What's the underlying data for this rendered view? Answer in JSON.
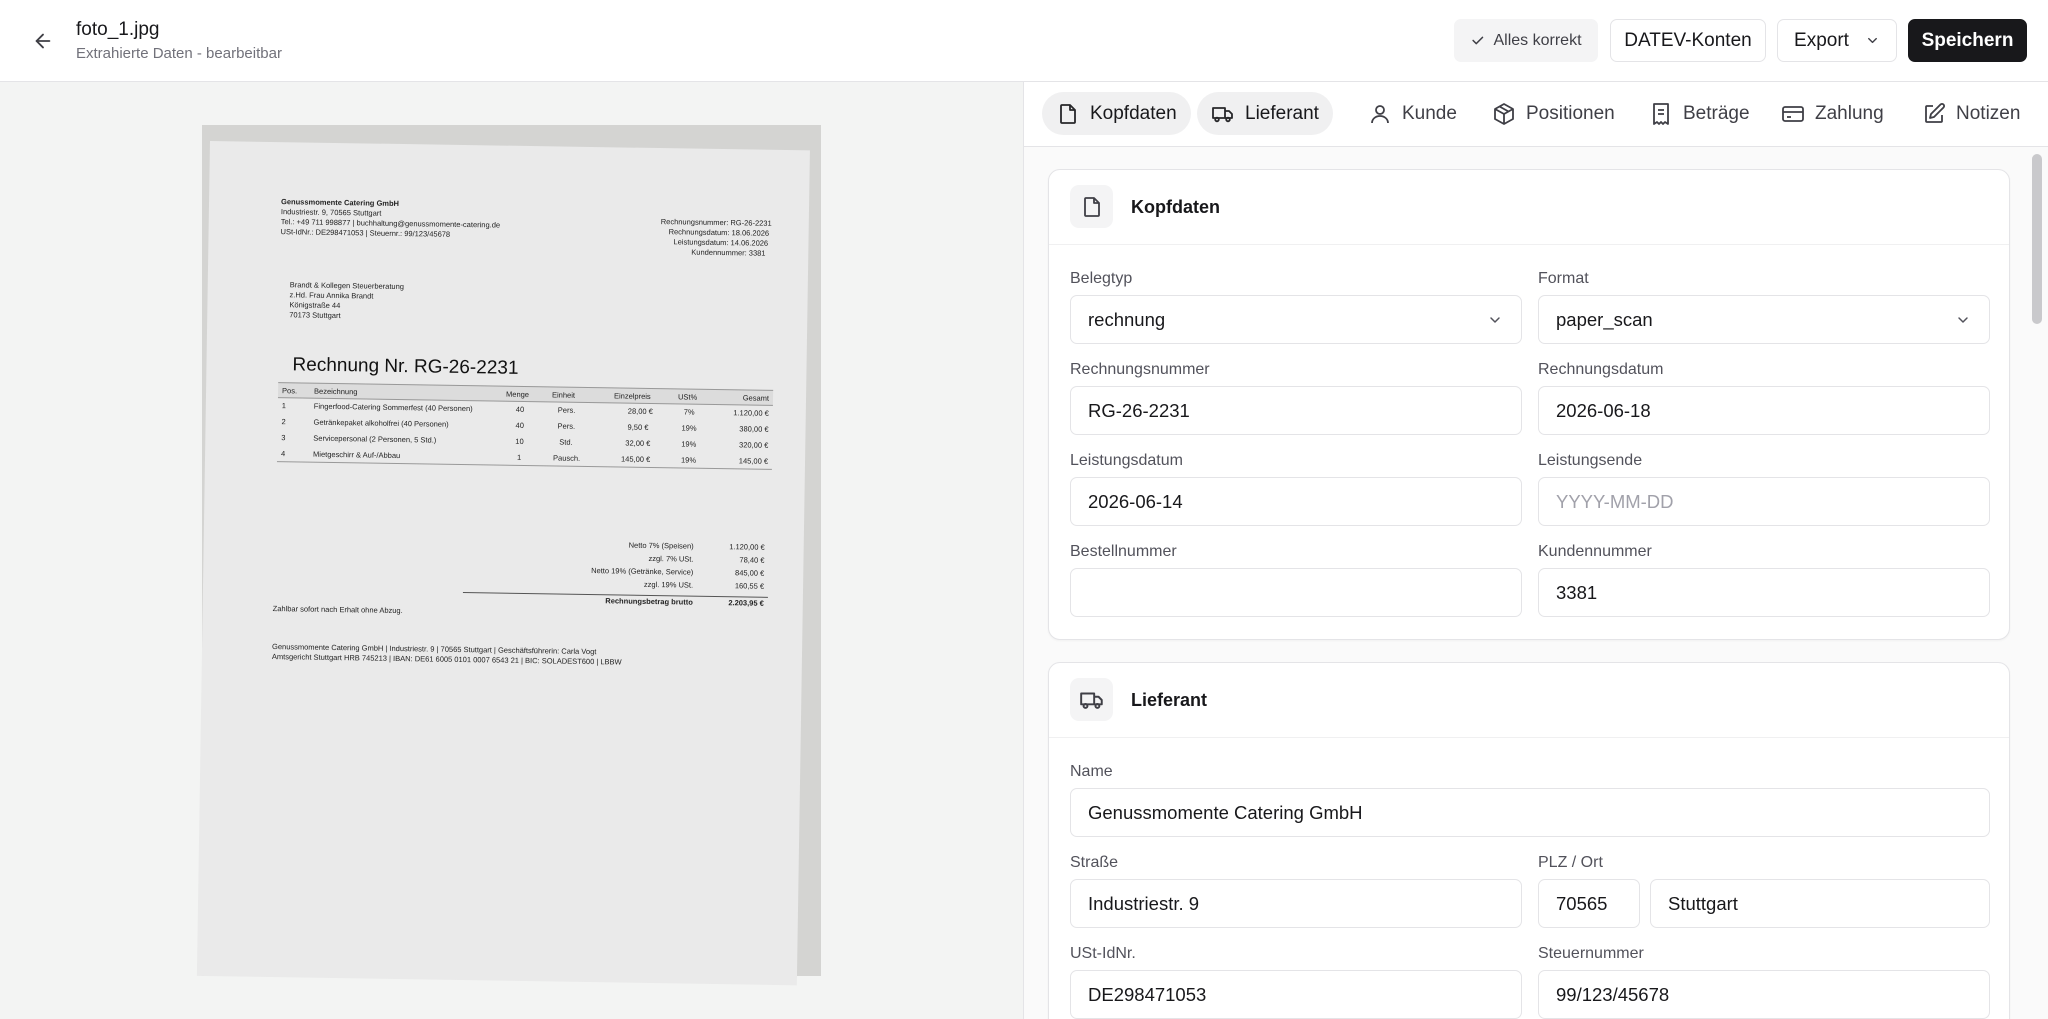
{
  "header": {
    "file_name": "foto_1.jpg",
    "subtitle": "Extrahierte Daten - bearbeitbar",
    "btn_ok": "Alles korrekt",
    "btn_datev": "DATEV-Konten",
    "btn_export": "Export",
    "btn_save": "Speichern"
  },
  "preview": {
    "sender_name": "Genussmomente Catering GmbH",
    "sender_line1": "Industriestr. 9, 70565 Stuttgart",
    "sender_line2": "Tel.: +49 711 998877 | buchhaltung@genussmomente-catering.de",
    "sender_line3": "USt-IdNr.: DE298471053 | Steuernr.: 99/123/45678",
    "meta_1": "Rechnungsnummer: RG-26-2231",
    "meta_2": "Rechnungsdatum: 18.06.2026",
    "meta_3": "Leistungsdatum: 14.06.2026",
    "meta_4": "Kundennummer: 3381",
    "recipient_1": "Brandt & Kollegen Steuerberatung",
    "recipient_2": "z.Hd. Frau Annika Brandt",
    "recipient_3": "Königstraße 44",
    "recipient_4": "70173 Stuttgart",
    "title": "Rechnung Nr. RG-26-2231",
    "table_headers": [
      "Pos.",
      "Bezeichnung",
      "Menge",
      "Einheit",
      "Einzelpreis",
      "USt%",
      "Gesamt"
    ],
    "rows": [
      [
        "1",
        "Fingerfood-Catering Sommerfest (40 Personen)",
        "40",
        "Pers.",
        "28,00 €",
        "7%",
        "1.120,00 €"
      ],
      [
        "2",
        "Getränkepaket alkoholfrei (40 Personen)",
        "40",
        "Pers.",
        "9,50 €",
        "19%",
        "380,00 €"
      ],
      [
        "3",
        "Servicepersonal (2 Personen, 5 Std.)",
        "10",
        "Std.",
        "32,00 €",
        "19%",
        "320,00 €"
      ],
      [
        "4",
        "Mietgeschirr & Auf-/Abbau",
        "1",
        "Pausch.",
        "145,00 €",
        "19%",
        "145,00 €"
      ]
    ],
    "sums": [
      [
        "Netto 7% (Speisen)",
        "1.120,00 €"
      ],
      [
        "zzgl. 7% USt.",
        "78,40 €"
      ],
      [
        "Netto 19% (Getränke, Service)",
        "845,00 €"
      ],
      [
        "zzgl. 19% USt.",
        "160,55 €"
      ]
    ],
    "total_label": "Rechnungsbetrag brutto",
    "total_value": "2.203,95 €",
    "payment_note": "Zahlbar sofort nach Erhalt ohne Abzug.",
    "footer_1": "Genussmomente Catering GmbH | Industriestr. 9 | 70565 Stuttgart | Geschäftsführerin: Carla Vogt",
    "footer_2": "Amtsgericht Stuttgart HRB 745213 | IBAN: DE61 6005 0101 0007 6543 21 | BIC: SOLADEST600 | LBBW"
  },
  "tabs": [
    "Kopfdaten",
    "Lieferant",
    "Kunde",
    "Positionen",
    "Beträge",
    "Zahlung",
    "Notizen"
  ],
  "kopfdaten": {
    "title": "Kopfdaten",
    "belegtyp_label": "Belegtyp",
    "belegtyp_value": "rechnung",
    "format_label": "Format",
    "format_value": "paper_scan",
    "rechnungsnummer_label": "Rechnungsnummer",
    "rechnungsnummer_value": "RG-26-2231",
    "rechnungsdatum_label": "Rechnungsdatum",
    "rechnungsdatum_value": "2026-06-18",
    "leistungsdatum_label": "Leistungsdatum",
    "leistungsdatum_value": "2026-06-14",
    "leistungsende_label": "Leistungsende",
    "leistungsende_placeholder": "YYYY-MM-DD",
    "bestellnummer_label": "Bestellnummer",
    "bestellnummer_value": "",
    "kundennummer_label": "Kundennummer",
    "kundennummer_value": "3381"
  },
  "lieferant": {
    "title": "Lieferant",
    "name_label": "Name",
    "name_value": "Genussmomente Catering GmbH",
    "strasse_label": "Straße",
    "strasse_value": "Industriestr. 9",
    "plz_ort_label": "PLZ / Ort",
    "plz_value": "70565",
    "ort_value": "Stuttgart",
    "ustid_label": "USt-IdNr.",
    "ustid_value": "DE298471053",
    "steuernr_label": "Steuernummer",
    "steuernr_value": "99/123/45678"
  }
}
